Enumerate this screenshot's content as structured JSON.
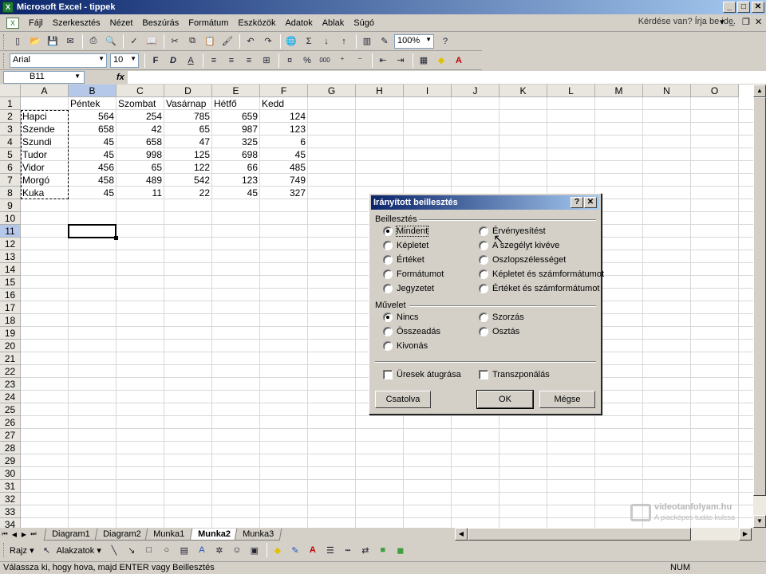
{
  "window": {
    "title": "Microsoft Excel - tippek",
    "min": "_",
    "max": "□",
    "close": "✕"
  },
  "menu": {
    "items": [
      "Fájl",
      "Szerkesztés",
      "Nézet",
      "Beszúrás",
      "Formátum",
      "Eszközök",
      "Adatok",
      "Ablak",
      "Súgó"
    ],
    "help_placeholder": "Kérdése van? Írja be ide.",
    "help_arrow": "▾",
    "doc_min": "_",
    "doc_restore": "❐",
    "doc_close": "✕"
  },
  "toolbar": {
    "zoom": "100%",
    "font_name": "Arial",
    "font_size": "10",
    "bold": "F",
    "italic": "D",
    "underline": "A",
    "autosum": "Σ",
    "percent": "%",
    "thousands": "000",
    "help": "?"
  },
  "formula_bar": {
    "name_box": "B11",
    "fx": "fx",
    "formula": ""
  },
  "sheet": {
    "columns": [
      "A",
      "B",
      "C",
      "D",
      "E",
      "F",
      "G",
      "H",
      "I",
      "J",
      "K",
      "L",
      "M",
      "N",
      "O"
    ],
    "rows": [
      "1",
      "2",
      "3",
      "4",
      "5",
      "6",
      "7",
      "8",
      "9",
      "10",
      "11",
      "12",
      "13",
      "14",
      "15",
      "16",
      "17",
      "18",
      "19",
      "20",
      "21",
      "22",
      "23",
      "24",
      "25",
      "26",
      "27",
      "28",
      "29",
      "30",
      "31",
      "32",
      "33",
      "34"
    ],
    "selected_column": "B",
    "selected_row": "11",
    "headers": [
      "Péntek",
      "Szombat",
      "Vasárnap",
      "Hétfő",
      "Kedd"
    ],
    "names": [
      "Hapci",
      "Szende",
      "Szundi",
      "Tudor",
      "Vidor",
      "Morgó",
      "Kuka"
    ],
    "values": [
      [
        "564",
        "254",
        "785",
        "659",
        "124"
      ],
      [
        "658",
        "42",
        "65",
        "987",
        "123"
      ],
      [
        "45",
        "658",
        "47",
        "325",
        "6"
      ],
      [
        "45",
        "998",
        "125",
        "698",
        "45"
      ],
      [
        "456",
        "65",
        "122",
        "66",
        "485"
      ],
      [
        "458",
        "489",
        "542",
        "123",
        "749"
      ],
      [
        "45",
        "11",
        "22",
        "45",
        "327"
      ]
    ]
  },
  "tabs": {
    "items": [
      "Diagram1",
      "Diagram2",
      "Munka1",
      "Munka2",
      "Munka3"
    ],
    "active": "Munka2"
  },
  "drawing": {
    "draw": "Rajz",
    "autoshapes": "Alakzatok"
  },
  "status": {
    "message": "Válassza ki, hogy hova, majd ENTER vagy Beillesztés",
    "num": "NUM"
  },
  "watermark": {
    "line1": "videotanfolyam.hu",
    "line2": "A piacképes tudás kulcsa"
  },
  "dialog": {
    "title": "Irányított beillesztés",
    "help": "?",
    "close": "✕",
    "paste_group": "Beillesztés",
    "paste_options": [
      {
        "label": "Mindent",
        "checked": true
      },
      {
        "label": "Képletet",
        "checked": false
      },
      {
        "label": "Értéket",
        "checked": false
      },
      {
        "label": "Formátumot",
        "checked": false
      },
      {
        "label": "Jegyzetet",
        "checked": false
      },
      {
        "label": "Érvényesítést",
        "checked": false
      },
      {
        "label": "A szegélyt kivéve",
        "checked": false
      },
      {
        "label": "Oszlopszélességet",
        "checked": false
      },
      {
        "label": "Képletet és számformátumot",
        "checked": false
      },
      {
        "label": "Értéket és számformátumot",
        "checked": false
      }
    ],
    "operation_group": "Művelet",
    "operation_options": [
      {
        "label": "Nincs",
        "checked": true
      },
      {
        "label": "Összeadás",
        "checked": false
      },
      {
        "label": "Kivonás",
        "checked": false
      },
      {
        "label": "Szorzás",
        "checked": false
      },
      {
        "label": "Osztás",
        "checked": false
      }
    ],
    "skip_blanks": "Üresek átugrása",
    "transpose": "Transzponálás",
    "paste_link": "Csatolva",
    "ok": "OK",
    "cancel": "Mégse"
  }
}
